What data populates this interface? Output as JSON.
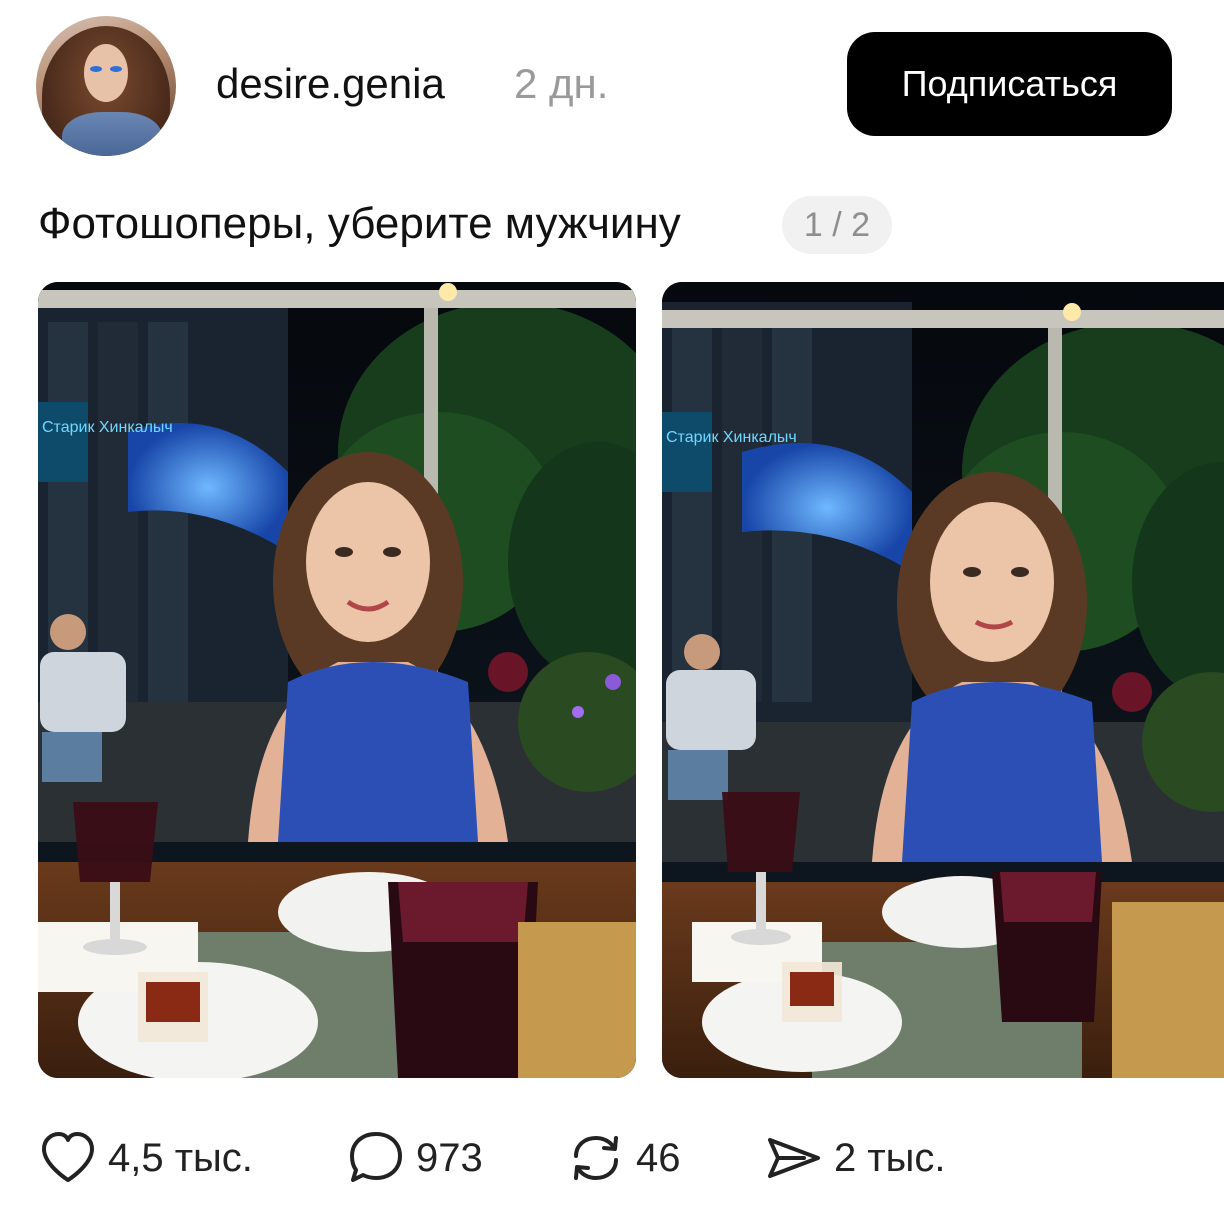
{
  "author": {
    "username": "desire.genia",
    "age": "2 дн."
  },
  "subscribe_label": "Подписаться",
  "post": {
    "text": "Фотошоперы, уберите мужчину",
    "page_counter": "1 / 2"
  },
  "photos": [
    {
      "name": "photo-1",
      "sign_text": "Старик Хинкалыч"
    },
    {
      "name": "photo-2",
      "sign_text": "Старик Хинкалыч"
    }
  ],
  "actions": {
    "likes": "4,5 тыс.",
    "comments": "973",
    "reposts": "46",
    "shares": "2 тыс."
  },
  "colors": {
    "button_bg": "#000000",
    "button_text": "#ffffff",
    "muted_text": "#9a9a9a",
    "counter_bg": "#f1f1f1"
  }
}
